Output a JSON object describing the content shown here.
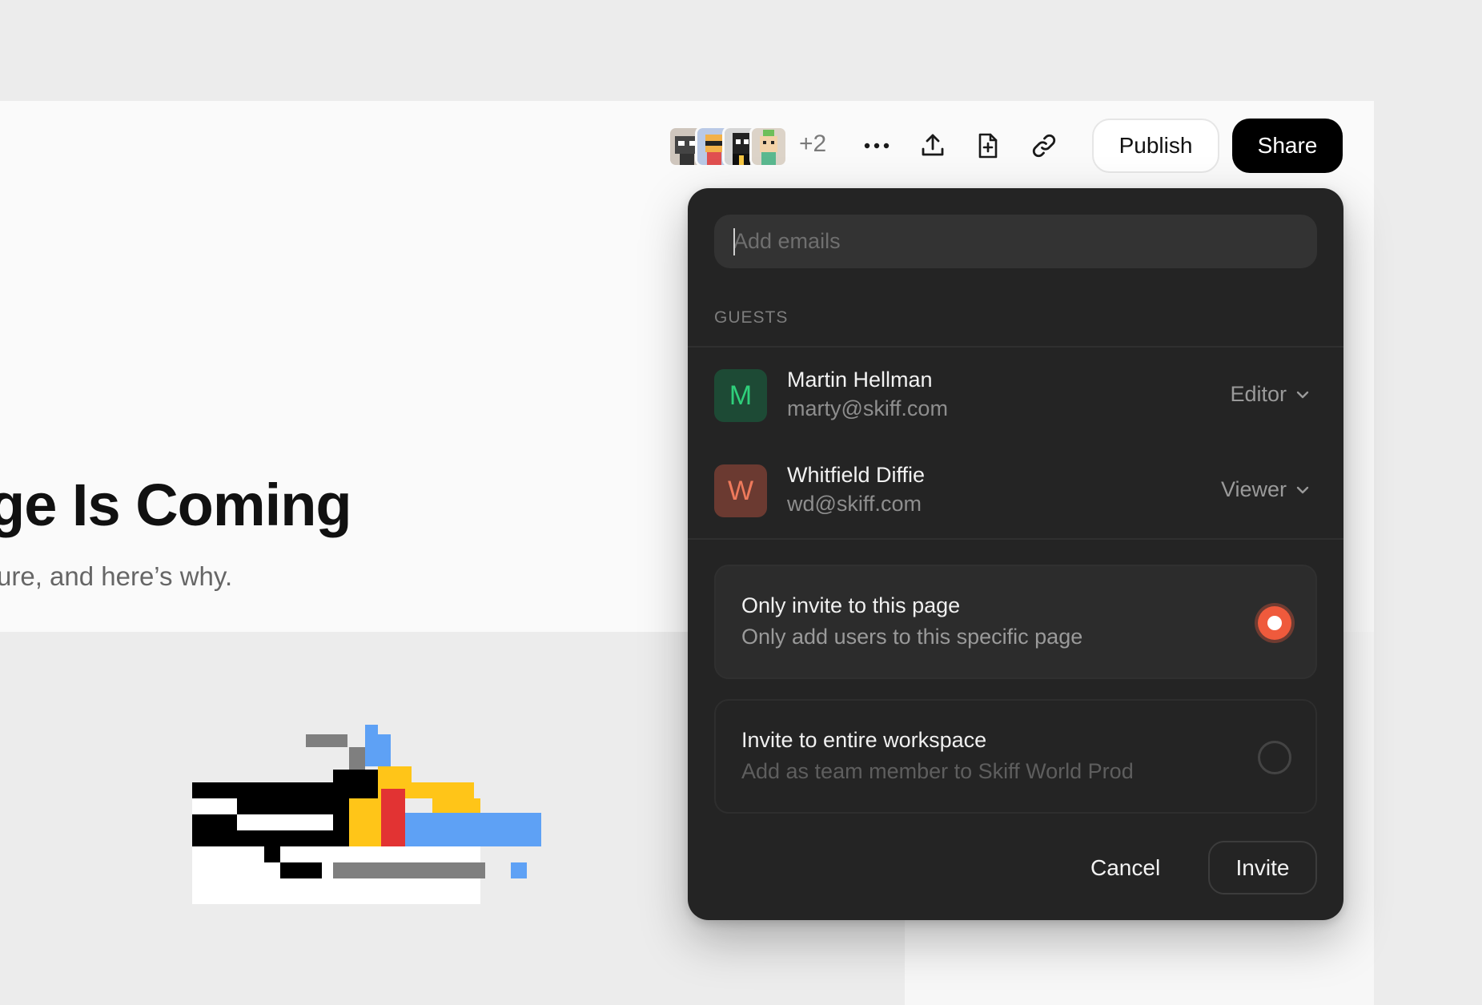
{
  "document": {
    "title": "ge Is Coming",
    "subtitle": "ure, and here’s why."
  },
  "toolbar": {
    "avatar_overflow": "+2",
    "icons": [
      "more-icon",
      "upload-icon",
      "new-page-icon",
      "link-icon"
    ],
    "publish_label": "Publish",
    "share_label": "Share"
  },
  "share_modal": {
    "email_placeholder": "Add emails",
    "guests_label": "GUESTS",
    "guests": [
      {
        "initial": "M",
        "name": "Martin Hellman",
        "email": "marty@skiff.com",
        "role": "Editor",
        "avatar_bg": "#1d4a35",
        "avatar_fg": "#2fd07b"
      },
      {
        "initial": "W",
        "name": "Whitfield Diffie",
        "email": "wd@skiff.com",
        "role": "Viewer",
        "avatar_bg": "#6b3a31",
        "avatar_fg": "#ef7a5c"
      }
    ],
    "options": [
      {
        "title": "Only invite to this page",
        "description": "Only add users to this specific page",
        "selected": true
      },
      {
        "title": "Invite to entire workspace",
        "description": "Add as team member to Skiff World Prod",
        "selected": false
      }
    ],
    "cancel_label": "Cancel",
    "invite_label": "Invite"
  },
  "colors": {
    "accent": "#ef5a3c",
    "modal_bg": "#242424",
    "share_button_bg": "#000000"
  }
}
